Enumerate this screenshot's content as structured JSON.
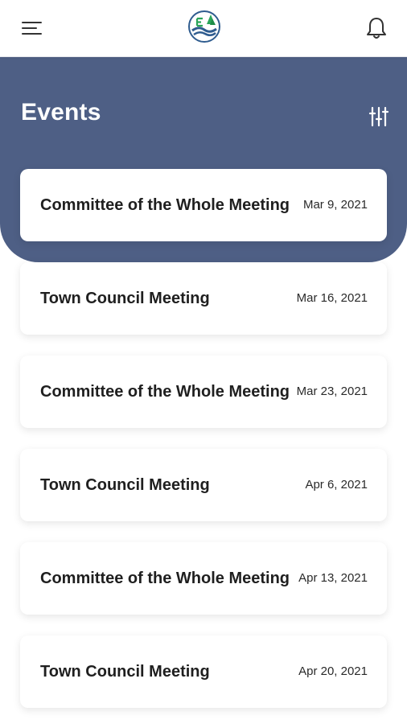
{
  "header": {
    "menu_icon": "hamburger-menu-icon",
    "logo_icon": "town-logo-icon",
    "notification_icon": "bell-icon"
  },
  "hero": {
    "title": "Events",
    "filter_icon": "sliders-filter-icon",
    "background_color": "#4e5f85"
  },
  "events": [
    {
      "title": "Committee of the Whole Meeting",
      "date": "Mar 9, 2021"
    },
    {
      "title": "Town Council Meeting",
      "date": "Mar 16, 2021"
    },
    {
      "title": "Committee of the Whole Meeting",
      "date": "Mar 23, 2021"
    },
    {
      "title": "Town Council Meeting",
      "date": "Apr 6, 2021"
    },
    {
      "title": "Committee of the Whole Meeting",
      "date": "Apr 13, 2021"
    },
    {
      "title": "Town Council Meeting",
      "date": "Apr 20, 2021"
    }
  ]
}
